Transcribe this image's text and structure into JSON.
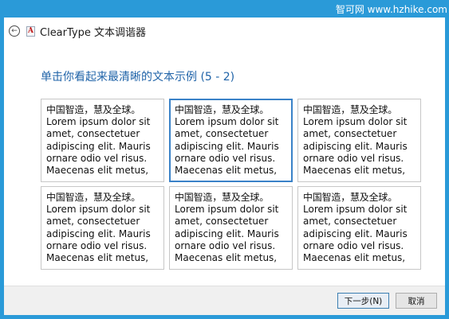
{
  "watermark": "智可网 www.hzhike.com",
  "window": {
    "title": "ClearType 文本调谐器",
    "app_icon_letter": "A",
    "back_icon": "back-arrow-icon"
  },
  "instruction": "单击你看起来最清晰的文本示例 (5 - 2)",
  "samples": [
    {
      "heading": "中国智造，慧及全球。",
      "lines": [
        "Lorem ipsum dolor sit",
        "amet, consectetuer",
        "adipiscing elit. Mauris",
        "ornare odio vel risus.",
        "Maecenas elit metus,"
      ],
      "selected": false
    },
    {
      "heading": "中国智造，慧及全球。",
      "lines": [
        "Lorem ipsum dolor sit",
        "amet, consectetuer",
        "adipiscing elit. Mauris",
        "ornare odio vel risus.",
        "Maecenas elit metus,"
      ],
      "selected": true
    },
    {
      "heading": "中国智造，慧及全球。",
      "lines": [
        "Lorem ipsum dolor sit",
        "amet, consectetuer",
        "adipiscing elit. Mauris",
        "ornare odio vel risus.",
        "Maecenas elit metus,"
      ],
      "selected": false
    },
    {
      "heading": "中国智造，慧及全球。",
      "lines": [
        "Lorem ipsum dolor sit",
        "amet, consectetuer",
        "adipiscing elit. Mauris",
        "ornare odio vel risus.",
        "Maecenas elit metus,"
      ],
      "selected": false
    },
    {
      "heading": "中国智造，慧及全球。",
      "lines": [
        "Lorem ipsum dolor sit",
        "amet, consectetuer",
        "adipiscing elit. Mauris",
        "ornare odio vel risus.",
        "Maecenas elit metus,"
      ],
      "selected": false
    },
    {
      "heading": "中国智造，慧及全球。",
      "lines": [
        "Lorem ipsum dolor sit",
        "amet, consectetuer",
        "adipiscing elit. Mauris",
        "ornare odio vel risus.",
        "Maecenas elit metus,"
      ],
      "selected": false
    }
  ],
  "buttons": {
    "next": "下一步(N)",
    "cancel": "取消"
  },
  "colors": {
    "desktop_background": "#2a9ad8",
    "instruction_text": "#1f63a8",
    "selection_border": "#3a82c8"
  }
}
